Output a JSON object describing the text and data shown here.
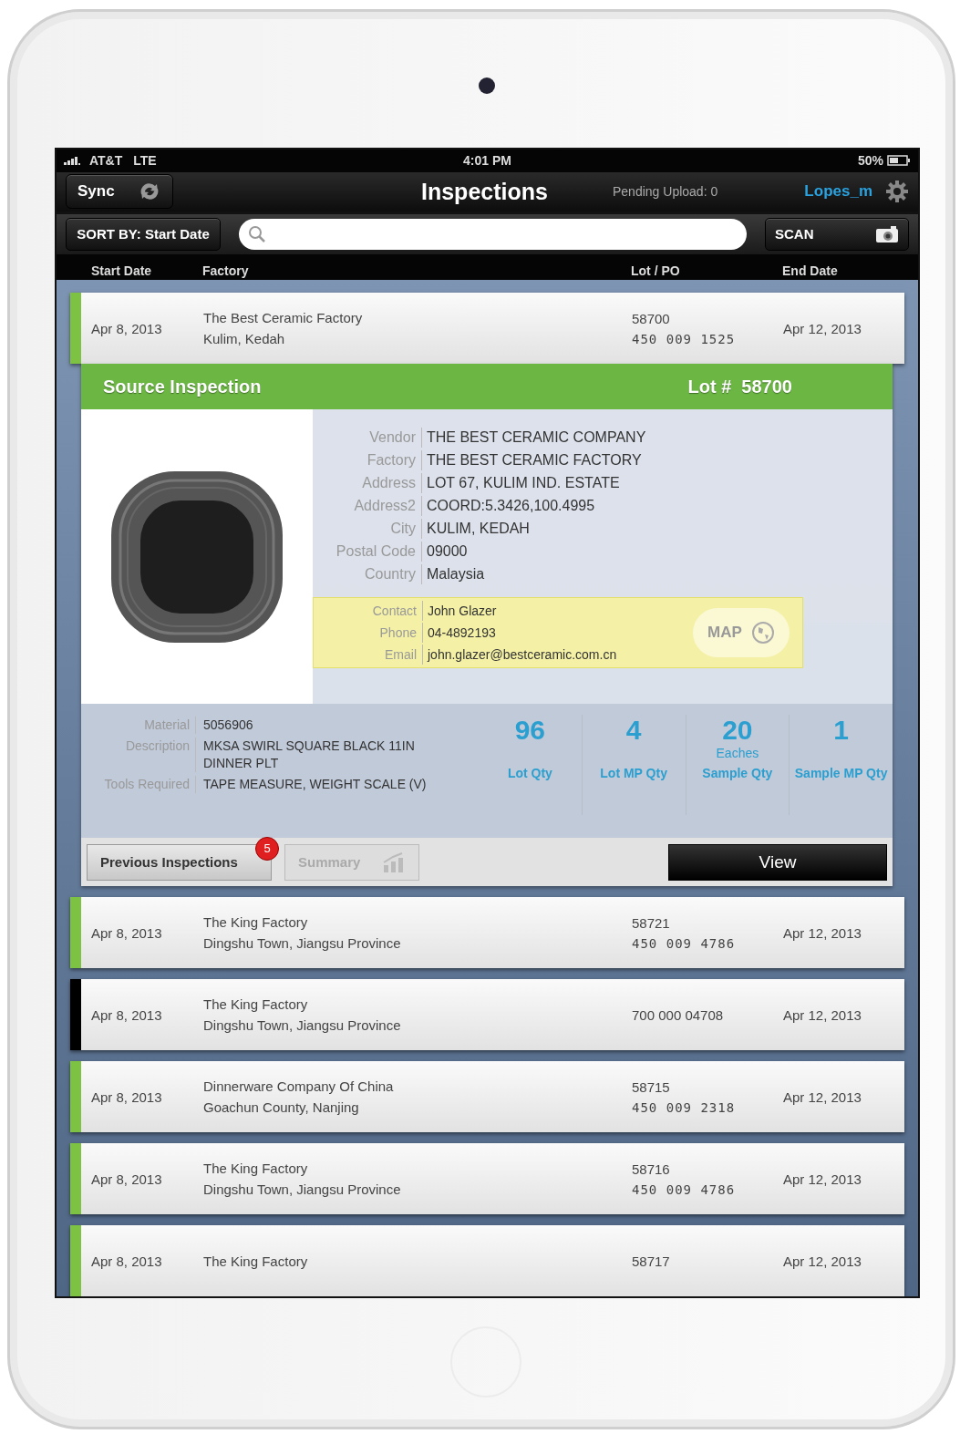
{
  "status_bar": {
    "carrier": "AT&T",
    "network": "LTE",
    "time": "4:01 PM",
    "battery": "50%"
  },
  "nav": {
    "sync": "Sync",
    "title": "Inspections",
    "pending_label": "Pending Upload:",
    "pending_count": "0",
    "user": "Lopes_m"
  },
  "toolbar": {
    "sort": "SORT BY: Start Date",
    "scan": "SCAN"
  },
  "columns": [
    "Start Date",
    "Factory",
    "Lot / PO",
    "End Date"
  ],
  "rows": [
    {
      "start": "Apr 8, 2013",
      "factory": "The Best Ceramic Factory",
      "location": "Kulim, Kedah",
      "lot": "58700",
      "po": "450 009 1525",
      "end": "Apr 12, 2013",
      "color": "#7dc242",
      "expanded": true
    },
    {
      "start": "Apr 8, 2013",
      "factory": "The King Factory",
      "location": "Dingshu Town, Jiangsu Province",
      "lot": "58721",
      "po": "450 009 4786",
      "end": "Apr 12, 2013",
      "color": "#7dc242",
      "expanded": false
    },
    {
      "start": "Apr 8, 2013",
      "factory": "The King Factory",
      "location": "Dingshu Town, Jiangsu Province",
      "lot": "700 000 04708",
      "end": "Apr 12, 2013",
      "color": "#000000",
      "expanded": false
    },
    {
      "start": "Apr 8, 2013",
      "factory": "Dinnerware Company Of China",
      "location": "Goachun County, Nanjing",
      "lot": "58715",
      "po": "450 009 2318",
      "end": "Apr 12, 2013",
      "color": "#7dc242",
      "expanded": false
    },
    {
      "start": "Apr 8, 2013",
      "factory": "The King Factory",
      "location": "Dingshu Town, Jiangsu Province",
      "lot": "58716",
      "po": "450 009 4786",
      "end": "Apr 12, 2013",
      "color": "#7dc242",
      "expanded": false
    },
    {
      "start": "Apr 8, 2013",
      "factory": "The King Factory",
      "lot": "58717",
      "end": "Apr 12, 2013",
      "color": "#7dc242",
      "expanded": false
    }
  ],
  "detail": {
    "title": "Source Inspection",
    "lot_label": "Lot #",
    "lot": "58700",
    "fields": [
      {
        "label": "Vendor",
        "value": "THE BEST CERAMIC COMPANY"
      },
      {
        "label": "Factory",
        "value": "THE BEST CERAMIC FACTORY"
      },
      {
        "label": "Address",
        "value": "LOT 67, KULIM IND. ESTATE"
      },
      {
        "label": "Address2",
        "value": "COORD:5.3426,100.4995"
      },
      {
        "label": "City",
        "value": "KULIM, KEDAH"
      },
      {
        "label": "Postal Code",
        "value": "09000"
      },
      {
        "label": "Country",
        "value": "Malaysia"
      }
    ],
    "contact": [
      {
        "label": "Contact",
        "value": "John Glazer"
      },
      {
        "label": "Phone",
        "value": "04-4892193"
      },
      {
        "label": "Email",
        "value": "john.glazer@bestceramic.com.cn"
      }
    ],
    "map": "MAP",
    "specs": [
      {
        "label": "Material",
        "value": "5056906"
      },
      {
        "label": "Description",
        "value": "MKSA SWIRL SQUARE BLACK 11IN DINNER PLT"
      },
      {
        "label": "Tools Required",
        "value": "TAPE MEASURE, WEIGHT SCALE (V)"
      }
    ],
    "quantities": [
      {
        "value": "96",
        "label": "Lot Qty"
      },
      {
        "value": "4",
        "label": "Lot MP Qty"
      },
      {
        "value": "20",
        "unit": "Eaches",
        "label": "Sample Qty"
      },
      {
        "value": "1",
        "label": "Sample MP Qty"
      }
    ],
    "previous": {
      "label": "Previous Inspections",
      "badge": "5"
    },
    "summary": {
      "label": "Summary",
      "disabled": true
    },
    "view": "View"
  }
}
